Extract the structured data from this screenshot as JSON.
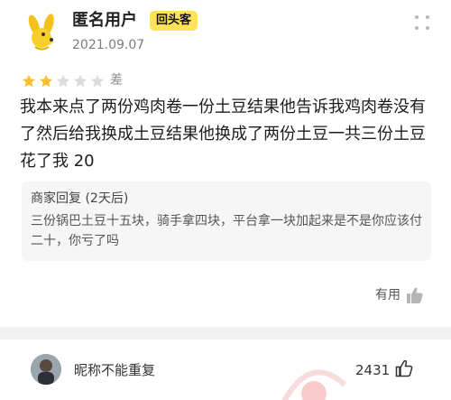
{
  "review": {
    "username": "匿名用户",
    "badge": "回头客",
    "date": "2021.09.07",
    "rating": 2,
    "rating_max": 5,
    "rating_label": "差",
    "text": "我本来点了两份鸡肉卷一份土豆结果他告诉我鸡肉卷没有了然后给我换成土豆结果他换成了两份土豆一共三份土豆花了我 20",
    "merchant_reply": {
      "title": "商家回复 (2天后)",
      "text": "三份锅巴土豆十五块，骑手拿四块，平台拿一块加起来是不是你应该付二十，你亏了吗"
    },
    "useful_label": "有用"
  },
  "next_comment": {
    "nickname": "昵称不能重复",
    "likes": "2431"
  },
  "colors": {
    "star_filled": "#f7c02f",
    "star_empty": "#dcdcdc",
    "badge_bg": "#ffe25c",
    "watermark": "#f4a3a3"
  },
  "icons": {
    "more": "more-vertical-icon",
    "thumb": "thumbs-up-icon",
    "star": "star-icon"
  }
}
